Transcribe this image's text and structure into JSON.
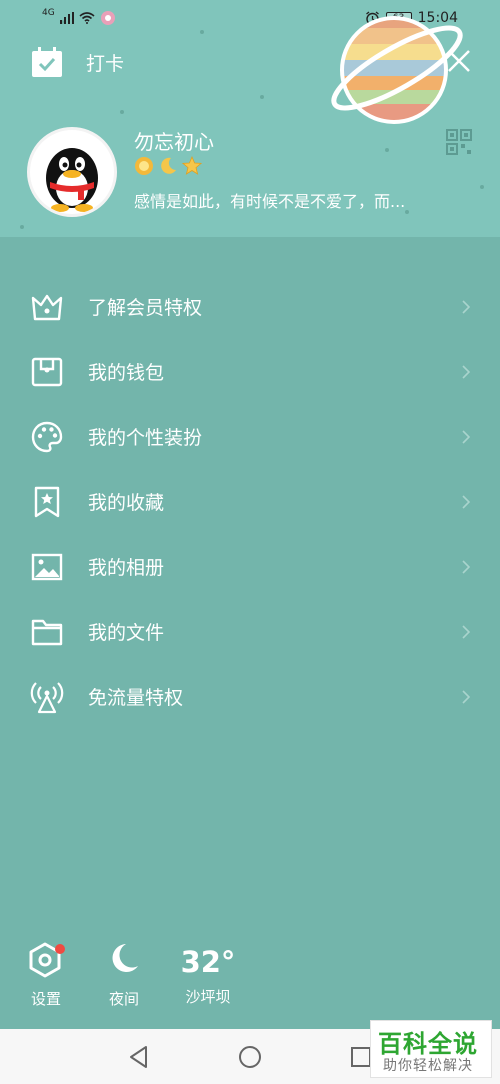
{
  "status_bar": {
    "network": "4G",
    "battery": "63",
    "time": "15:04"
  },
  "header": {
    "checkin_label": "打卡",
    "nickname": "勿忘初心",
    "signature": "感情是如此，有时候不是不爱了，而...",
    "badges": [
      "sun-badge-icon",
      "moon-badge-icon",
      "star-badge-icon"
    ]
  },
  "menu": {
    "items": [
      {
        "label": "了解会员特权",
        "icon": "crown-icon"
      },
      {
        "label": "我的钱包",
        "icon": "wallet-icon"
      },
      {
        "label": "我的个性装扮",
        "icon": "palette-icon"
      },
      {
        "label": "我的收藏",
        "icon": "bookmark-star-icon"
      },
      {
        "label": "我的相册",
        "icon": "image-icon"
      },
      {
        "label": "我的文件",
        "icon": "folder-icon"
      },
      {
        "label": "免流量特权",
        "icon": "signal-tower-icon"
      }
    ]
  },
  "tools": {
    "settings_label": "设置",
    "night_label": "夜间",
    "temperature": "32°",
    "city": "沙坪坝"
  },
  "watermark": {
    "title": "百科全说",
    "subtitle": "助你轻松解决"
  },
  "colors": {
    "header_bg": "#80c5bb",
    "body_bg": "#73b5ab",
    "notification_dot": "#f04a42",
    "watermark_green": "#2ea632"
  }
}
